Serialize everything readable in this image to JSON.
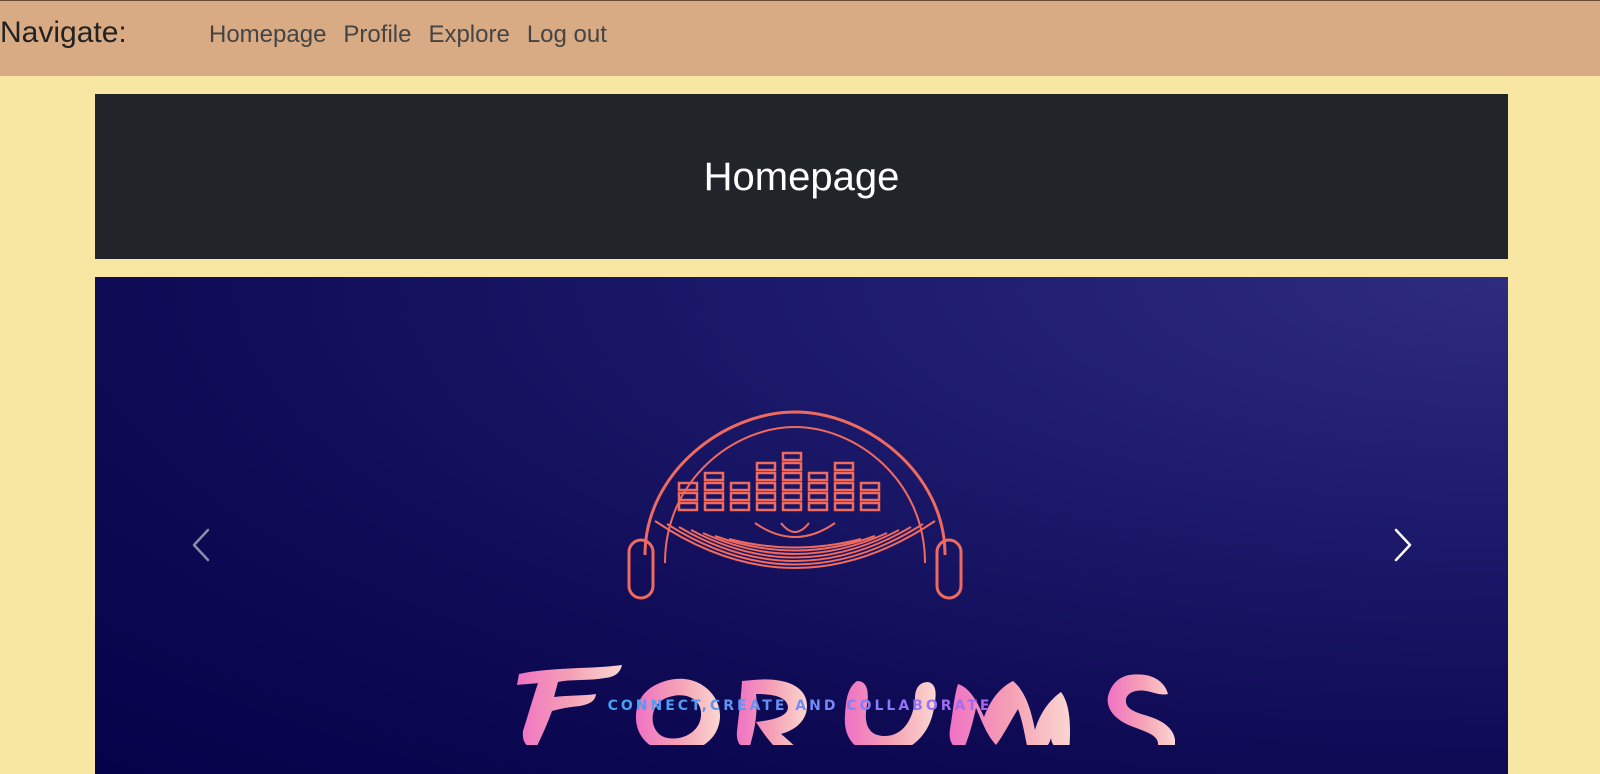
{
  "topbar": {
    "brand": "Navigate:",
    "links": [
      "Homepage",
      "Profile",
      "Explore",
      "Log out"
    ]
  },
  "header": {
    "title": "Homepage"
  },
  "carousel": {
    "slide_logo_text": "FORUMS",
    "slide_tagline": "CONNECT,CREATE AND COLLABORATE",
    "prev_icon": "chevron-left-icon",
    "next_icon": "chevron-right-icon"
  },
  "colors": {
    "topbar": "#d9ab84",
    "page_background": "#f8e7a2",
    "header_background": "#212428",
    "carousel_background": "#0e0a54",
    "logo_orange": "#e96a5f",
    "logo_pink": "#f07ccb"
  }
}
